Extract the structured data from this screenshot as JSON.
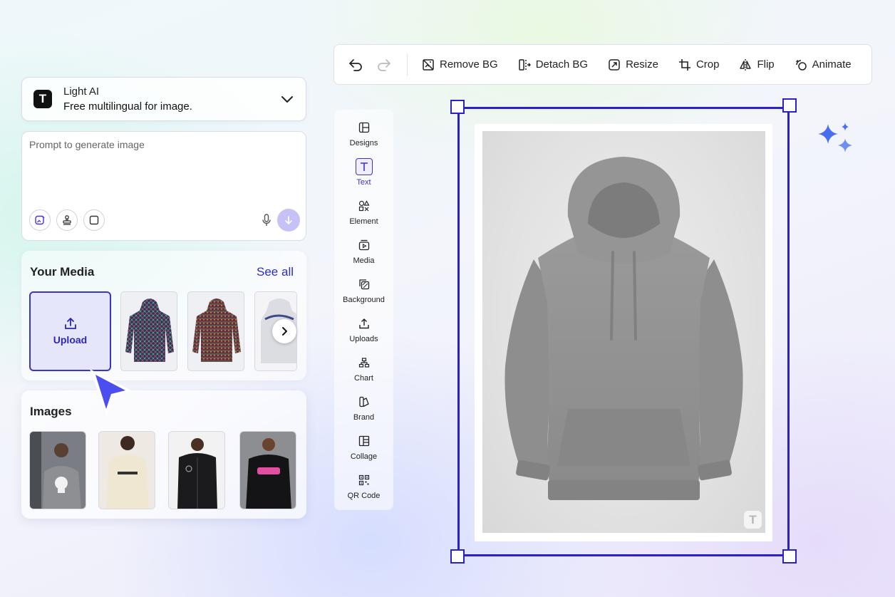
{
  "model": {
    "name": "Light AI",
    "description": "Free multilingual for image.",
    "logo_letter": "T"
  },
  "prompt": {
    "placeholder": "Prompt to generate image"
  },
  "media": {
    "title": "Your Media",
    "see_all": "See all",
    "upload_label": "Upload",
    "thumbs": [
      "dark-patterned-hoodie",
      "red-patterned-hoodie",
      "white-newyork-hoodie"
    ]
  },
  "images": {
    "title": "Images"
  },
  "toolbar": {
    "undo_icon": "undo-icon",
    "redo_icon": "redo-icon",
    "remove_bg": "Remove BG",
    "detach_bg": "Detach BG",
    "resize": "Resize",
    "crop": "Crop",
    "flip": "Flip",
    "animate": "Animate"
  },
  "side_tools": [
    {
      "label": "Designs",
      "icon": "layout-icon"
    },
    {
      "label": "Text",
      "icon": "text-icon",
      "active": true
    },
    {
      "label": "Element",
      "icon": "shapes-icon"
    },
    {
      "label": "Media",
      "icon": "media-icon"
    },
    {
      "label": "Background",
      "icon": "background-icon"
    },
    {
      "label": "Uploads",
      "icon": "upload-icon"
    },
    {
      "label": "Chart",
      "icon": "chart-icon"
    },
    {
      "label": "Brand",
      "icon": "brand-icon"
    },
    {
      "label": "Collage",
      "icon": "collage-icon"
    },
    {
      "label": "QR Code",
      "icon": "qr-code-icon"
    }
  ],
  "canvas": {
    "watermark_letter": "T"
  },
  "colors": {
    "accent": "#2a21c7",
    "send": "#c6c2f7",
    "upload_bg": "#e6e6fb"
  }
}
